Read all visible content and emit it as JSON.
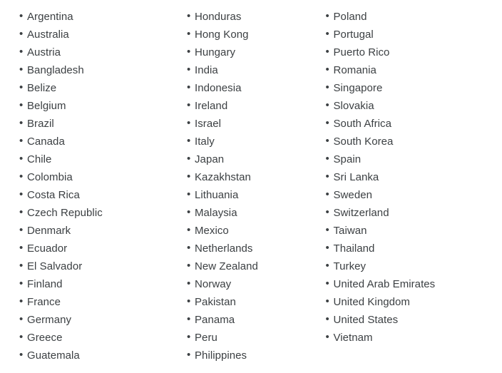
{
  "page": {
    "background_color": "#ffffff",
    "text_color": "#3c4043",
    "bullet_glyph": "•"
  },
  "country_list": {
    "columns": [
      {
        "column_index": 1,
        "items": [
          "Argentina",
          "Australia",
          "Austria",
          "Bangladesh",
          "Belize",
          "Belgium",
          "Brazil",
          "Canada",
          "Chile",
          "Colombia",
          "Costa Rica",
          "Czech Republic",
          "Denmark",
          "Ecuador",
          "El Salvador",
          "Finland",
          "France",
          "Germany",
          "Greece",
          "Guatemala"
        ]
      },
      {
        "column_index": 2,
        "items": [
          "Honduras",
          "Hong Kong",
          "Hungary",
          "India",
          "Indonesia",
          "Ireland",
          "Israel",
          "Italy",
          "Japan",
          "Kazakhstan",
          "Lithuania",
          "Malaysia",
          "Mexico",
          "Netherlands",
          "New Zealand",
          "Norway",
          "Pakistan",
          "Panama",
          "Peru",
          "Philippines"
        ]
      },
      {
        "column_index": 3,
        "items": [
          "Poland",
          "Portugal",
          "Puerto Rico",
          "Romania",
          "Singapore",
          "Slovakia",
          "South Africa",
          "South Korea",
          "Spain",
          "Sri Lanka",
          "Sweden",
          "Switzerland",
          "Taiwan",
          "Thailand",
          "Turkey",
          "United Arab Emirates",
          "United Kingdom",
          "United States",
          "Vietnam"
        ]
      }
    ]
  }
}
